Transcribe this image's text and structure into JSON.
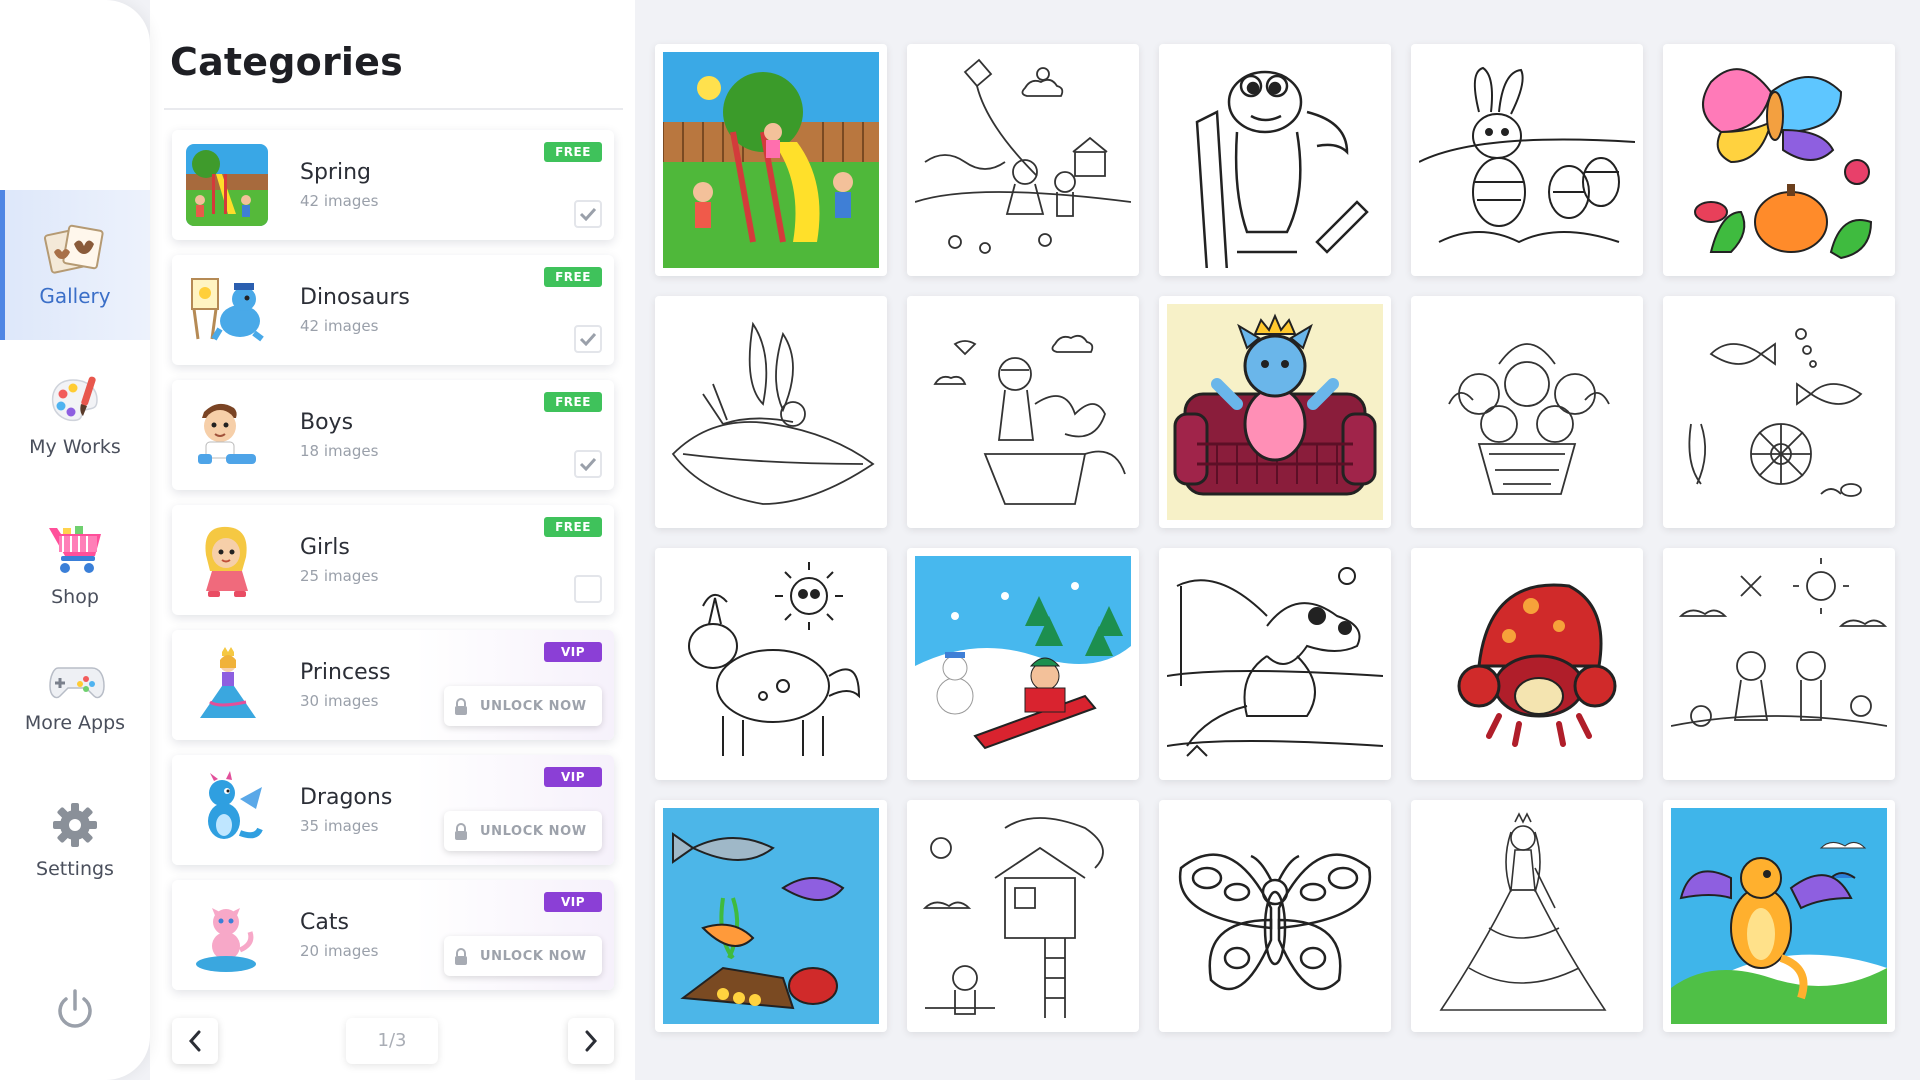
{
  "nav": {
    "items": [
      {
        "label": "Gallery",
        "icon": "gallery-icon",
        "active": true
      },
      {
        "label": "My Works",
        "icon": "palette-icon"
      },
      {
        "label": "Shop",
        "icon": "shopping-cart-icon"
      },
      {
        "label": "More Apps",
        "icon": "gamepad-icon"
      },
      {
        "label": "Settings",
        "icon": "gear-icon"
      }
    ],
    "power_icon": "power-icon"
  },
  "categories": {
    "title": "Categories",
    "items": [
      {
        "name": "Spring",
        "count": "42 images",
        "badge": "FREE",
        "state": "checked"
      },
      {
        "name": "Dinosaurs",
        "count": "42 images",
        "badge": "FREE",
        "state": "checked"
      },
      {
        "name": "Boys",
        "count": "18 images",
        "badge": "FREE",
        "state": "checked"
      },
      {
        "name": "Girls",
        "count": "25 images",
        "badge": "FREE",
        "state": "unchecked"
      },
      {
        "name": "Princess",
        "count": "30 images",
        "badge": "VIP",
        "state": "locked",
        "action": "UNLOCK NOW"
      },
      {
        "name": "Dragons",
        "count": "35 images",
        "badge": "VIP",
        "state": "locked",
        "action": "UNLOCK NOW"
      },
      {
        "name": "Cats",
        "count": "20 images",
        "badge": "VIP",
        "state": "locked",
        "action": "UNLOCK NOW"
      }
    ],
    "pagination": {
      "indicator": "1/3",
      "prev_icon": "chevron-left-icon",
      "next_icon": "chevron-right-icon"
    }
  },
  "gallery": {
    "tiles": [
      "playground-colored",
      "kite-kids-outline",
      "dinosaur-pencils-outline",
      "easter-bunny-outline",
      "butterfly-flowers-colored",
      "fairy-on-leaf-outline",
      "girl-with-dragon-outline",
      "king-cat-on-sofa-colored",
      "flower-basket-outline",
      "fish-underwater-outline",
      "unicorn-sun-outline",
      "winter-sled-colored",
      "dinosaur-fishing-outline",
      "mushroom-crab-colored",
      "kids-garden-outline",
      "underwater-shark-colored",
      "treehouse-outline",
      "butterfly-outline",
      "princess-outline",
      "dragon-colored"
    ]
  },
  "colors": {
    "accent": "#4f86e4",
    "free_badge": "#3fc25b",
    "vip_badge": "#8b3fd6",
    "background": "#f1f2f6"
  }
}
